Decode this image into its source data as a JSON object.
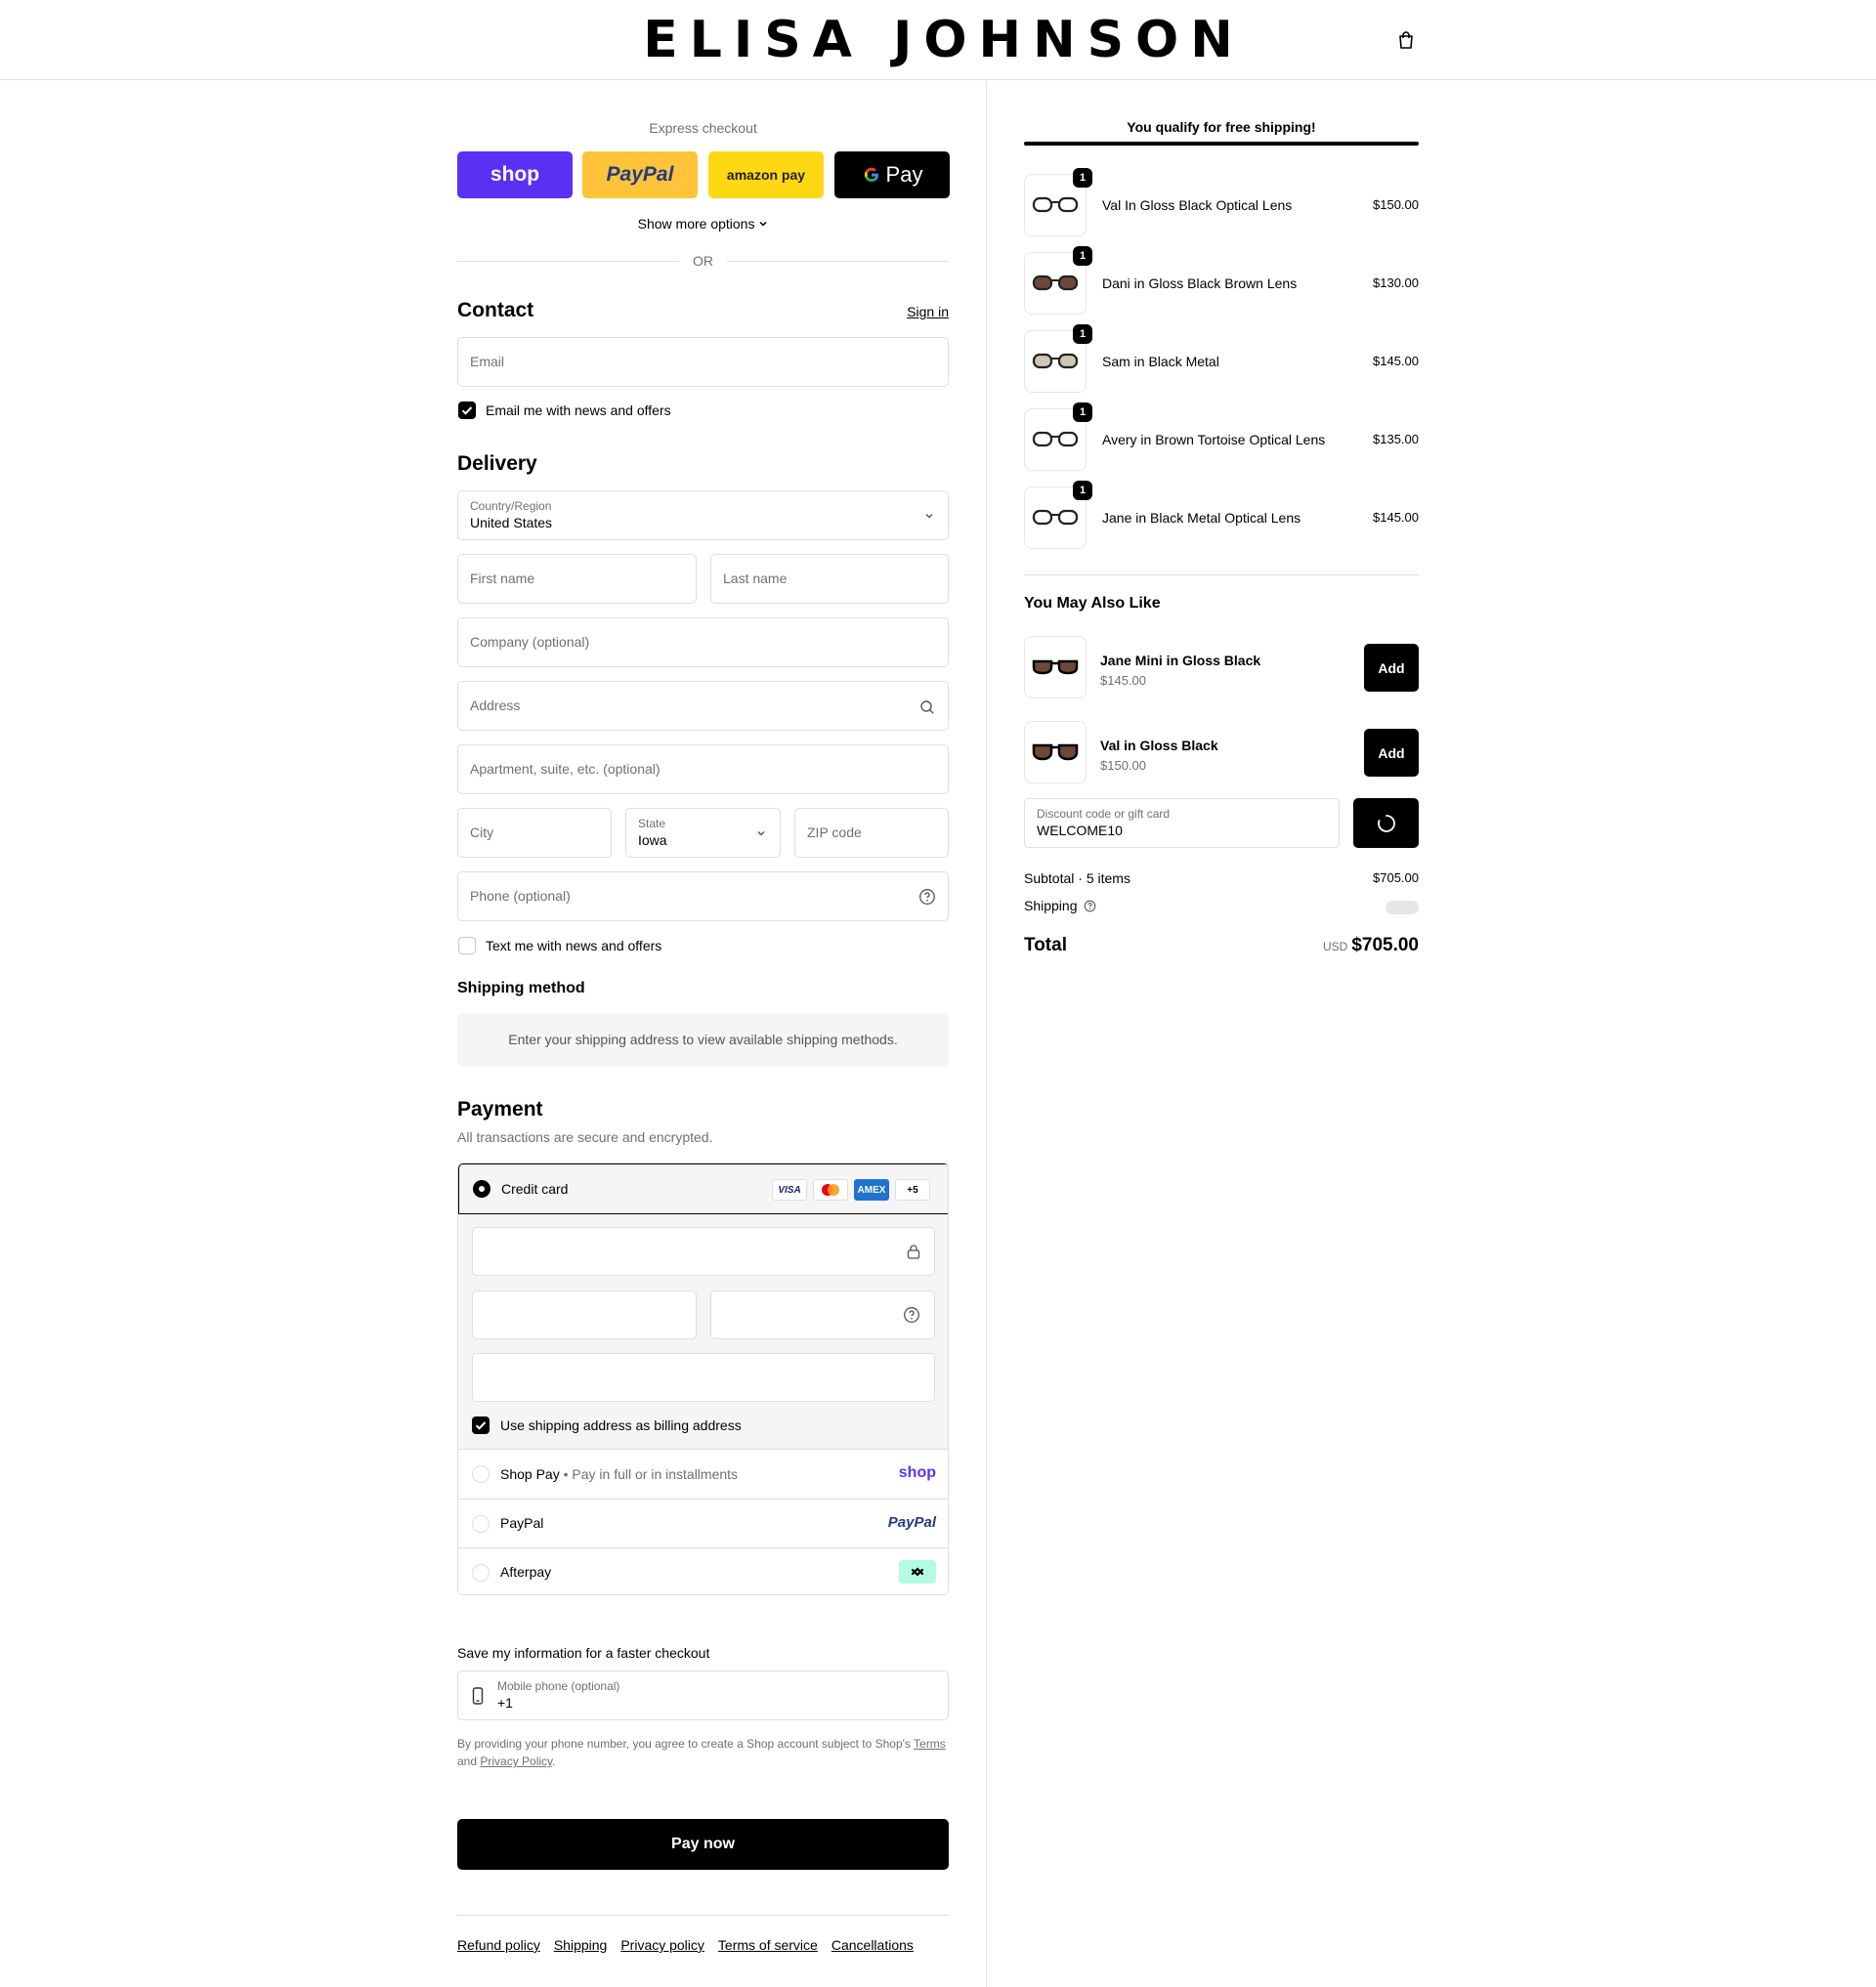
{
  "header": {
    "brand": "ELISA JOHNSON"
  },
  "express": {
    "label": "Express checkout",
    "shop_label": "shop",
    "paypal_label": "PayPal",
    "amazon_label": "amazon pay",
    "gpay_label": "Pay",
    "more_options": "Show more options",
    "or": "OR"
  },
  "contact": {
    "title": "Contact",
    "sign_in": "Sign in",
    "email_placeholder": "Email",
    "newsletter": "Email me with news and offers"
  },
  "delivery": {
    "title": "Delivery",
    "country_label": "Country/Region",
    "country_value": "United States",
    "first_name": "First name",
    "last_name": "Last name",
    "company": "Company (optional)",
    "address": "Address",
    "apartment": "Apartment, suite, etc. (optional)",
    "city": "City",
    "state_label": "State",
    "state_value": "Iowa",
    "zip": "ZIP code",
    "phone": "Phone (optional)",
    "text_offers": "Text me with news and offers"
  },
  "shipping_method": {
    "title": "Shipping method",
    "note": "Enter your shipping address to view available shipping methods."
  },
  "payment": {
    "title": "Payment",
    "subtitle": "All transactions are secure and encrypted.",
    "credit_card": "Credit card",
    "card_visa": "VISA",
    "card_amex": "AMEX",
    "card_more": "+5",
    "billing_same": "Use shipping address as billing address",
    "shop_pay": "Shop Pay",
    "shop_pay_sub": "Pay in full or in installments",
    "shop_pay_logo": "shop",
    "paypal": "PayPal",
    "paypal_logo": "PayPal",
    "afterpay": "Afterpay"
  },
  "save_info": {
    "title": "Save my information for a faster checkout",
    "mobile_label": "Mobile phone (optional)",
    "mobile_value": "+1",
    "legal_text": "By providing your phone number, you agree to create a Shop account subject to Shop's",
    "terms": "Terms",
    "and": "and",
    "privacy": "Privacy Policy",
    "period": "."
  },
  "pay_now": "Pay now",
  "footer": [
    "Refund policy",
    "Shipping",
    "Privacy policy",
    "Terms of service",
    "Cancellations"
  ],
  "summary": {
    "qualify": "You qualify for free shipping!",
    "items": [
      {
        "name": "Val In Gloss Black Optical Lens",
        "price": "$150.00",
        "qty": "1",
        "lens": "#ffffff"
      },
      {
        "name": "Dani in Gloss Black Brown Lens",
        "price": "$130.00",
        "qty": "1",
        "lens": "#6b4a3a"
      },
      {
        "name": "Sam in Black Metal",
        "price": "$145.00",
        "qty": "1",
        "lens": "#cfc6b6"
      },
      {
        "name": "Avery in Brown Tortoise Optical Lens",
        "price": "$135.00",
        "qty": "1",
        "lens": "#ffffff"
      },
      {
        "name": "Jane in Black Metal Optical Lens",
        "price": "$145.00",
        "qty": "1",
        "lens": "#ffffff"
      }
    ],
    "also_like_title": "You May Also Like",
    "upsell": [
      {
        "name": "Jane Mini in Gloss Black",
        "price": "$145.00",
        "button": "Add"
      },
      {
        "name": "Val in Gloss Black",
        "price": "$150.00",
        "button": "Add"
      }
    ],
    "discount_label": "Discount code or gift card",
    "discount_value": "WELCOME10",
    "subtotal_label": "Subtotal · 5 items",
    "subtotal_value": "$705.00",
    "shipping_label": "Shipping",
    "total_label": "Total",
    "currency": "USD",
    "total_value": "$705.00"
  },
  "colors": {
    "shop": "#5a31f4",
    "paypal": "#ffc439",
    "amazon": "#ffd814",
    "gpay": "#000000",
    "afterpay": "#b2fce4"
  }
}
